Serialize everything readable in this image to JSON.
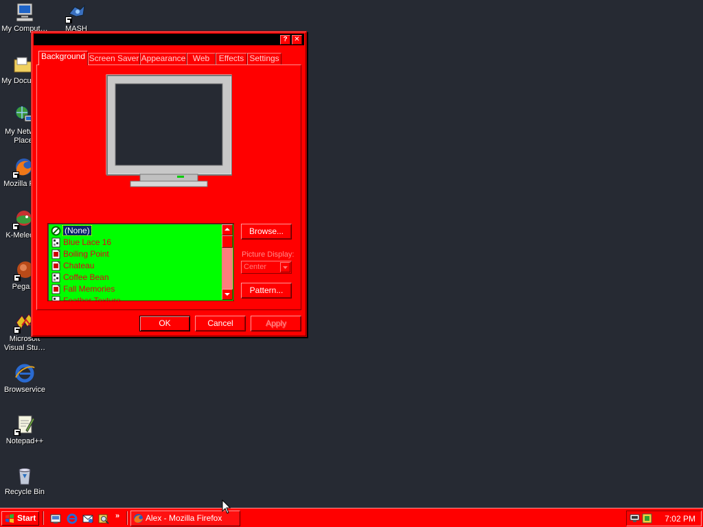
{
  "desktop": {
    "icons": [
      {
        "name": "my-computer",
        "label": "My Comput…",
        "label_display": "My Computer"
      },
      {
        "name": "mash",
        "label": "MASH"
      },
      {
        "name": "my-documents",
        "label": "My Docum…"
      },
      {
        "name": "my-network",
        "label": "My Netw…\nPlace"
      },
      {
        "name": "mozilla-firefox",
        "label": "Mozilla Fi…"
      },
      {
        "name": "k-meleon",
        "label": "K-Melec…"
      },
      {
        "name": "pegasus",
        "label": "Pega…"
      },
      {
        "name": "visual-studio",
        "label": "Microsoft\nVisual Stu…"
      },
      {
        "name": "browservice",
        "label": "Browservice"
      },
      {
        "name": "notepadpp",
        "label": "Notepad++"
      },
      {
        "name": "recycle-bin",
        "label": "Recycle Bin"
      }
    ]
  },
  "dialog": {
    "title": "",
    "help_label": "?",
    "close_label": "✕",
    "tabs": [
      {
        "label": "Background",
        "active": true
      },
      {
        "label": "Screen Saver",
        "active": false
      },
      {
        "label": "Appearance",
        "active": false
      },
      {
        "label": "Web",
        "active": false
      },
      {
        "label": "Effects",
        "active": false
      },
      {
        "label": "Settings",
        "active": false
      }
    ],
    "wallpapers": [
      {
        "label": "(None)",
        "selected": true,
        "icon": "none-icon"
      },
      {
        "label": "Blue Lace 16",
        "selected": false,
        "icon": "wallpaper-tiled-icon"
      },
      {
        "label": "Boiling Point",
        "selected": false,
        "icon": "wallpaper-image-icon"
      },
      {
        "label": "Chateau",
        "selected": false,
        "icon": "wallpaper-image-icon"
      },
      {
        "label": "Coffee Bean",
        "selected": false,
        "icon": "wallpaper-tiled-icon"
      },
      {
        "label": "Fall Memories",
        "selected": false,
        "icon": "wallpaper-image-icon"
      },
      {
        "label": "Feather Texture",
        "selected": false,
        "icon": "wallpaper-tiled-icon"
      }
    ],
    "browse_label": "Browse...",
    "picture_display_label": "Picture Display:",
    "picture_display_value": "Center",
    "pattern_label": "Pattern...",
    "ok_label": "OK",
    "cancel_label": "Cancel",
    "apply_label": "Apply"
  },
  "taskbar": {
    "start_label": "Start",
    "quick_launch": [
      "show-desktop-icon",
      "internet-explorer-icon",
      "outlook-express-icon",
      "search-icon"
    ],
    "more_label": "»",
    "task_label": "Alex - Mozilla Firefox",
    "clock": "7:02 PM"
  },
  "colors": {
    "theme_red": "#ff0000",
    "list_green": "#00ff00",
    "desktop_bg": "#262a33",
    "selection": "#0a246a"
  }
}
